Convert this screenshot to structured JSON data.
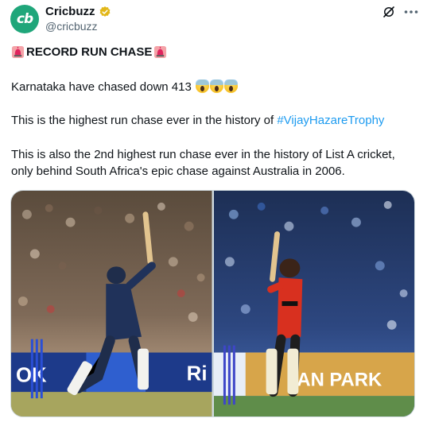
{
  "account": {
    "display_name": "Cricbuzz",
    "handle": "@cricbuzz",
    "avatar_text": "cb",
    "verified": true
  },
  "tweet": {
    "headline": "RECORD RUN CHASE",
    "line1": "Karnataka have chased down 413",
    "line2_prefix": "This is the highest run chase ever in the history of ",
    "line2_hashtag": "#VijayHazareTrophy",
    "line3": "This is also the 2nd highest run chase ever in the history of List A cricket,",
    "line4": "only behind South Africa's epic chase against Australia in 2006."
  },
  "icons": {
    "siren": "police-siren-emoji",
    "scream": "face-screaming-in-fear-emoji",
    "grok": "grok-icon",
    "more": "more-horizontal-icon"
  },
  "media": {
    "left_photo": {
      "description_tag": "batter-navy-kit",
      "board_text": "Ri",
      "board_text_2": "OK"
    },
    "right_photo": {
      "description_tag": "batter-red-kit",
      "board_text": "AN PARK"
    }
  },
  "colors": {
    "accent": "#1d9bf0",
    "brand": "#1fa67a",
    "verified_gold": "#e2b719"
  }
}
